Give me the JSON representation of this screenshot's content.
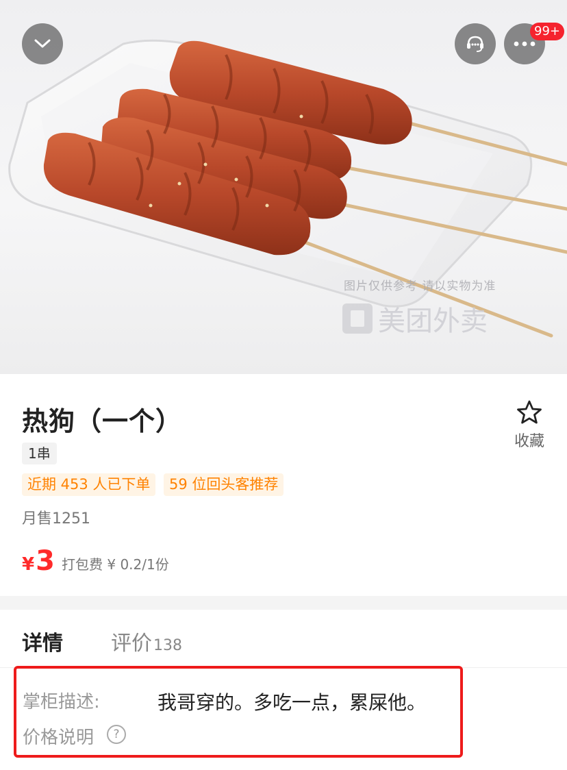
{
  "hero": {
    "watermark_note": "图片仅供参考 请以实物为准",
    "watermark_brand": "美团外卖",
    "badge_count": "99+",
    "icons": [
      "chevron-down-icon",
      "customer-service-icon",
      "more-icon"
    ]
  },
  "product": {
    "name": "热狗（一个）",
    "spec": "1串",
    "promo_tags": [
      "近期 453 人已下单",
      "59 位回头客推荐"
    ],
    "monthly_sales": "月售1251",
    "price_currency": "¥",
    "price_value": "3",
    "packing_fee": "打包费 ¥ 0.2/1份",
    "favorite_label": "收藏"
  },
  "tabs": {
    "detail": "详情",
    "review": "评价",
    "review_count": "138"
  },
  "description": {
    "label": "掌柜描述:",
    "text": "我哥穿的。多吃一点，累屎他。",
    "price_note_label": "价格说明",
    "help_symbol": "?"
  },
  "colors": {
    "price_red": "#ff2a2a",
    "promo_orange": "#ff8200",
    "promo_bg": "#fff4e5",
    "highlight_red": "#ee1b1b",
    "badge_red": "#f5232e"
  }
}
